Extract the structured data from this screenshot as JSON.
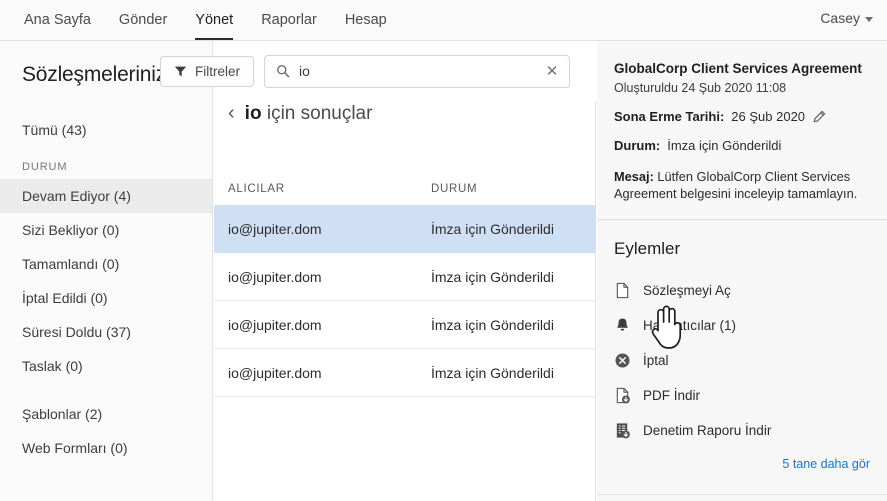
{
  "topnav": {
    "items": [
      {
        "label": "Ana Sayfa",
        "active": false
      },
      {
        "label": "Gönder",
        "active": false
      },
      {
        "label": "Yönet",
        "active": true
      },
      {
        "label": "Raporlar",
        "active": false
      },
      {
        "label": "Hesap",
        "active": false
      }
    ],
    "user": "Casey"
  },
  "sidebar": {
    "title": "Sözleşmeleriniz",
    "all_item": "Tümü (43)",
    "status_header": "DURUM",
    "status_items": [
      {
        "label": "Devam Ediyor (4)",
        "selected": true
      },
      {
        "label": "Sizi Bekliyor (0)",
        "selected": false
      },
      {
        "label": "Tamamlandı (0)",
        "selected": false
      },
      {
        "label": "İptal Edildi (0)",
        "selected": false
      },
      {
        "label": "Süresi Doldu (37)",
        "selected": false
      },
      {
        "label": "Taslak (0)",
        "selected": false
      }
    ],
    "extra_items": [
      {
        "label": "Şablonlar (2)"
      },
      {
        "label": "Web Formları (0)"
      }
    ]
  },
  "toolbar": {
    "filter_label": "Filtreler",
    "search_value": "io",
    "search_placeholder": "",
    "clear_glyph": "✕"
  },
  "results": {
    "back_glyph": "‹",
    "query": "io",
    "title_suffix": " için sonuçlar",
    "columns": {
      "recipients": "ALICILAR",
      "status": "DURUM"
    },
    "rows": [
      {
        "recipient": "io@jupiter.dom",
        "status": "İmza için Gönderildi",
        "selected": true
      },
      {
        "recipient": "io@jupiter.dom",
        "status": "İmza için Gönderildi",
        "selected": false
      },
      {
        "recipient": "io@jupiter.dom",
        "status": "İmza için Gönderildi",
        "selected": false
      },
      {
        "recipient": "io@jupiter.dom",
        "status": "İmza için Gönderildi",
        "selected": false
      }
    ]
  },
  "detail": {
    "doc_title": "GlobalCorp Client Services Agreement",
    "created": "Oluşturuldu 24 Şub 2020 11:08",
    "expiry_label": "Sona Erme Tarihi:",
    "expiry_value": "26 Şub 2020",
    "status_label": "Durum:",
    "status_value": "İmza için Gönderildi",
    "message_label": "Mesaj:",
    "message_value": "Lütfen GlobalCorp Client Services Agreement belgesini inceleyip tamamlayın."
  },
  "actions": {
    "title": "Eylemler",
    "items": [
      {
        "label": "Sözleşmeyi Aç",
        "icon": "document-icon"
      },
      {
        "label": "Hatırlatıcılar (1)",
        "icon": "bell-icon"
      },
      {
        "label": "İptal",
        "icon": "cancel-icon"
      },
      {
        "label": "PDF İndir",
        "icon": "pdf-download-icon"
      },
      {
        "label": "Denetim Raporu İndir",
        "icon": "audit-download-icon"
      }
    ],
    "more_link": "5 tane daha gör"
  },
  "colors": {
    "accent_link": "#1473e6",
    "row_selected": "#cfe0f5",
    "sidebar_selected": "#ebebeb",
    "panel_bg": "#f7f7f7"
  }
}
